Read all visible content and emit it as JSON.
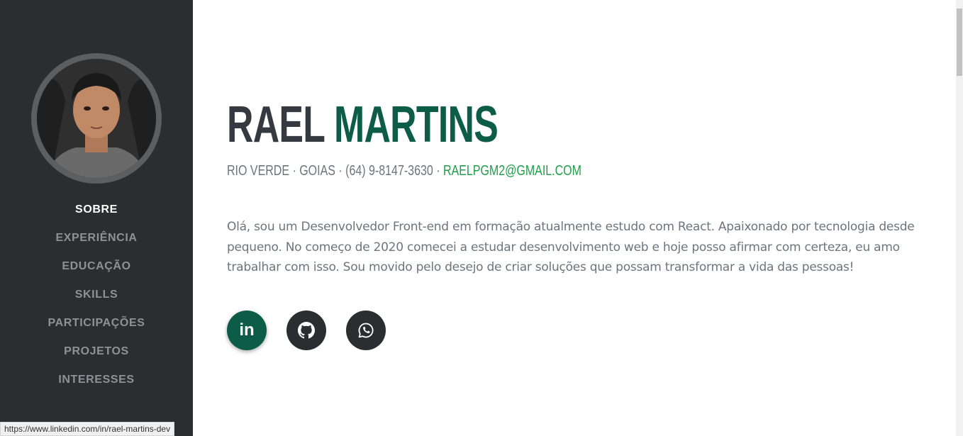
{
  "profile": {
    "first_name": "RAEL",
    "last_name": "MARTINS",
    "location": "RIO VERDE · GOIAS · (64) 9-8147-3630 ·",
    "email": "RAELPGM2@GMAIL.COM",
    "about": "Olá, sou um Desenvolvedor Front-end em formação atualmente estudo com React. Apaixonado por tecnologia desde pequeno. No começo de 2020 comecei a estudar desenvolvimento web e hoje posso afirmar com certeza, eu amo trabalhar com isso. Sou movido pelo desejo de criar soluções que possam transformar a vida das pessoas!"
  },
  "sidebar": {
    "items": [
      {
        "label": "SOBRE",
        "active": true
      },
      {
        "label": "EXPERIÊNCIA",
        "active": false
      },
      {
        "label": "EDUCAÇÃO",
        "active": false
      },
      {
        "label": "SKILLS",
        "active": false
      },
      {
        "label": "PARTICIPAÇÕES",
        "active": false
      },
      {
        "label": "PROJETOS",
        "active": false
      },
      {
        "label": "INTERESSES",
        "active": false
      }
    ]
  },
  "social": {
    "linkedin_label": "in",
    "icons": [
      "linkedin-icon",
      "github-icon",
      "whatsapp-icon"
    ]
  },
  "status_bar": {
    "url": "https://www.linkedin.com/in/rael-martins-dev"
  },
  "colors": {
    "sidebar_bg": "#2a2e31",
    "accent": "#0c5c47",
    "email": "#229e4b",
    "text_muted": "#6c757d",
    "heading": "#343a40"
  }
}
